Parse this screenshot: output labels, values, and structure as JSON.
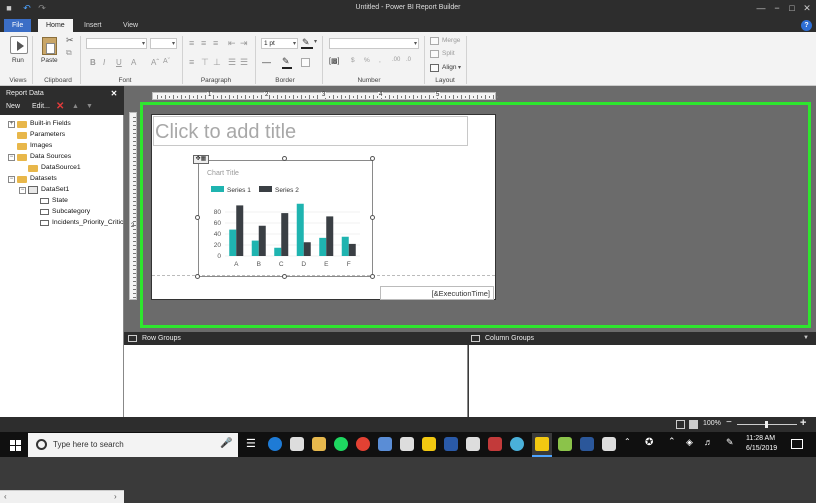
{
  "window": {
    "title": "Untitled - Power BI Report Builder"
  },
  "tabs": [
    {
      "label": "File"
    },
    {
      "label": "Home"
    },
    {
      "label": "Insert"
    },
    {
      "label": "View"
    }
  ],
  "help_icon": "question-icon",
  "ribbon": {
    "groups": {
      "views": "Views",
      "clipboard": "Clipboard",
      "font": "Font",
      "paragraph": "Paragraph",
      "border": "Border",
      "number": "Number",
      "layout": "Layout"
    },
    "run_label": "Run",
    "paste_label": "Paste",
    "border_width": "1 pt",
    "merge_label": "Merge",
    "split_label": "Split",
    "align_label": "Align"
  },
  "report_data": {
    "title": "Report Data",
    "new_label": "New",
    "edit_label": "Edit...",
    "tree": [
      {
        "label": "Built-in Fields"
      },
      {
        "label": "Parameters"
      },
      {
        "label": "Images"
      },
      {
        "label": "Data Sources"
      },
      {
        "label": "DataSource1"
      },
      {
        "label": "Datasets"
      },
      {
        "label": "DataSet1"
      },
      {
        "label": "State"
      },
      {
        "label": "Subcategory"
      },
      {
        "label": "Incidents_Priority_Critic"
      }
    ]
  },
  "ruler": {
    "marks": [
      "1",
      "2",
      "3",
      "4",
      "5"
    ],
    "vmark": "2"
  },
  "canvas": {
    "title_placeholder": "Click to add title",
    "execution_time": "[&ExecutionTime]"
  },
  "chart_data": {
    "type": "bar",
    "title": "Chart Title",
    "categories": [
      "A",
      "B",
      "C",
      "D",
      "E",
      "F"
    ],
    "series": [
      {
        "name": "Series 1",
        "color": "#1fb4b0",
        "values": [
          48,
          28,
          15,
          95,
          33,
          35
        ]
      },
      {
        "name": "Series 2",
        "color": "#3a3f44",
        "values": [
          92,
          55,
          78,
          25,
          72,
          22
        ]
      }
    ],
    "y_ticks": [
      "0",
      "20",
      "40",
      "60",
      "80"
    ],
    "ylim": [
      0,
      100
    ]
  },
  "groups": {
    "row_label": "Row Groups",
    "column_label": "Column Groups"
  },
  "status": {
    "zoom": "100%"
  },
  "taskbar": {
    "search_placeholder": "Type here to search",
    "time": "11:28 AM",
    "date": "6/15/2019"
  }
}
